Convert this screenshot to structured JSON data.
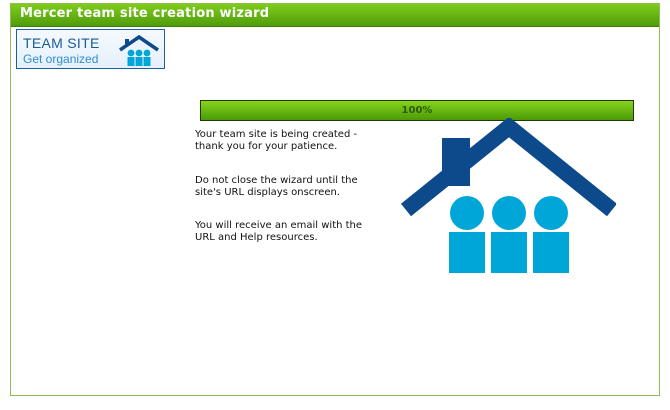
{
  "window": {
    "title": "Mercer team site creation wizard"
  },
  "logo": {
    "line1": "TEAM SITE",
    "line2": "Get organized",
    "icon": "house-family-icon"
  },
  "progress": {
    "percent_label": "100%",
    "value": 1.0
  },
  "messages": {
    "m1": "Your team site is being created - thank you for your patience.",
    "m2": "Do not close the wizard until the site's URL displays onscreen.",
    "m3": "You will receive an email with the URL and Help resources."
  },
  "illustration": {
    "icon": "house-family-icon"
  },
  "colors": {
    "title_bar": "#5aac10",
    "progress_fill": "#5aaa0a",
    "house_roof": "#0c4a8c",
    "people": "#00a6d8"
  }
}
